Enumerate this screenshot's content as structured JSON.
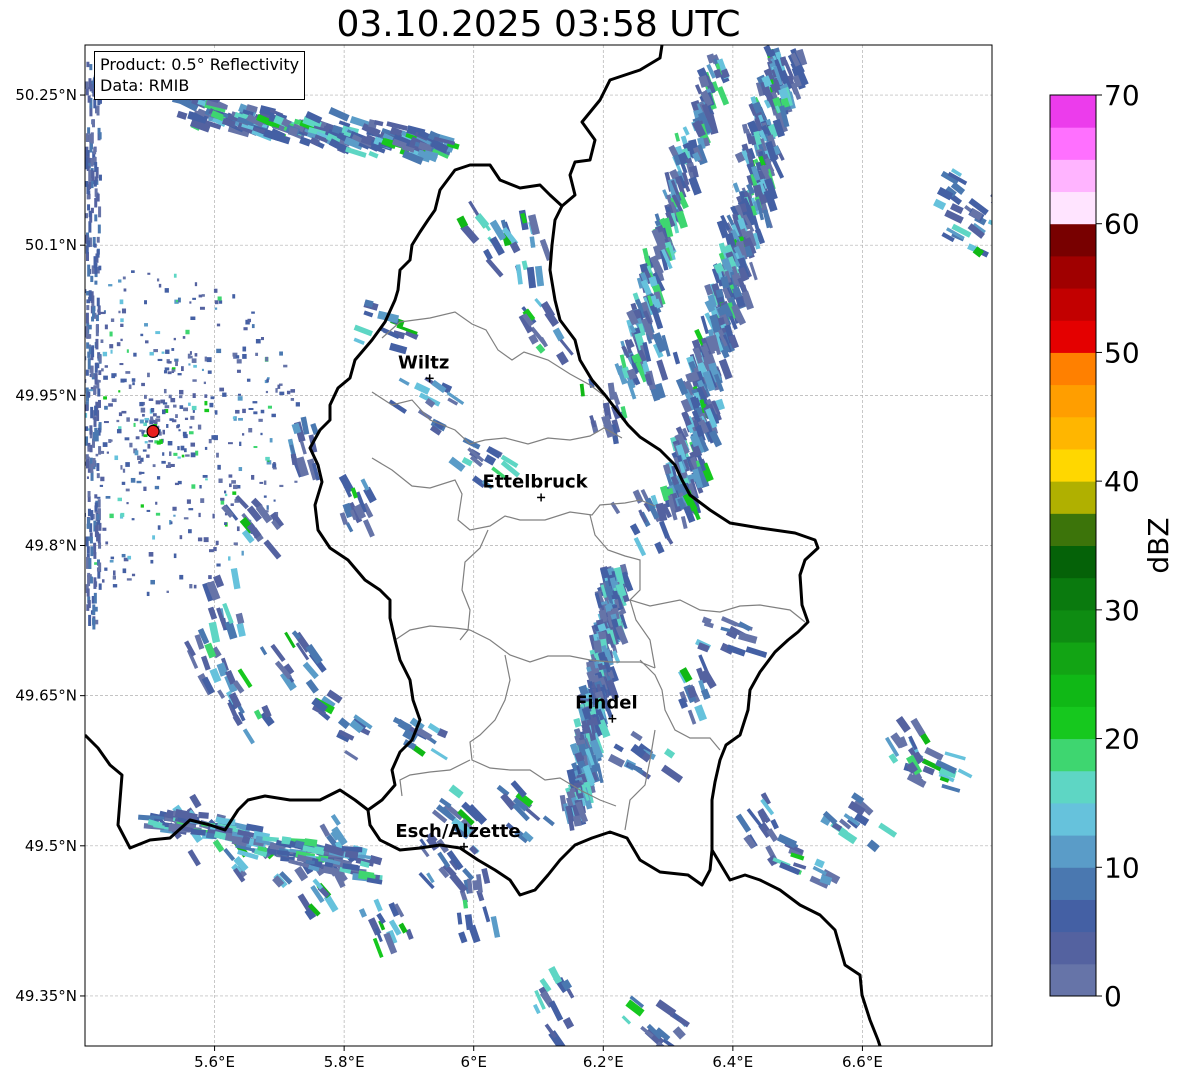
{
  "title": "03.10.2025 03:58 UTC",
  "info": {
    "product": "Product: 0.5° Reflectivity",
    "data": "Data: RMIB"
  },
  "map": {
    "lon_range": [
      5.4,
      6.8
    ],
    "lat_range": [
      49.3,
      50.3
    ],
    "x_ticks": [
      {
        "value": 5.6,
        "label": "5.6°E"
      },
      {
        "value": 5.8,
        "label": "5.8°E"
      },
      {
        "value": 6.0,
        "label": "6°E"
      },
      {
        "value": 6.2,
        "label": "6.2°E"
      },
      {
        "value": 6.4,
        "label": "6.4°E"
      },
      {
        "value": 6.6,
        "label": "6.6°E"
      }
    ],
    "y_ticks": [
      {
        "value": 50.25,
        "label": "50.25°N"
      },
      {
        "value": 50.1,
        "label": "50.1°N"
      },
      {
        "value": 49.95,
        "label": "49.95°N"
      },
      {
        "value": 49.8,
        "label": "49.8°N"
      },
      {
        "value": 49.65,
        "label": "49.65°N"
      },
      {
        "value": 49.5,
        "label": "49.5°N"
      },
      {
        "value": 49.35,
        "label": "49.35°N"
      }
    ],
    "grid": true,
    "radar_site": {
      "lon": 5.505,
      "lat": 49.914,
      "color": "#e8201c"
    },
    "cities": [
      {
        "name": "Wiltz",
        "lon": 5.932,
        "lat": 49.967
      },
      {
        "name": "Ettelbruck",
        "lon": 6.104,
        "lat": 49.848
      },
      {
        "name": "Findel",
        "lon": 6.214,
        "lat": 49.627
      },
      {
        "name": "Esch/Alzette",
        "lon": 5.985,
        "lat": 49.499
      }
    ]
  },
  "colorbar": {
    "label": "dBZ",
    "min": 0,
    "max": 70,
    "tick_values": [
      0,
      10,
      20,
      30,
      40,
      50,
      60,
      70
    ],
    "tick_labels": [
      "0",
      "10",
      "20",
      "30",
      "40",
      "50",
      "60",
      "70"
    ],
    "colors": [
      "#6674a8",
      "#5462a0",
      "#4460a4",
      "#4a78b0",
      "#5a9cc8",
      "#66c2dc",
      "#5ed6c4",
      "#3ed670",
      "#16c81e",
      "#10b816",
      "#12a414",
      "#0e8c12",
      "#0a7a0e",
      "#056208",
      "#3c740a",
      "#b0b000",
      "#ffd700",
      "#ffb600",
      "#ff9e00",
      "#ff8000",
      "#e40000",
      "#c20000",
      "#a00000",
      "#780000",
      "#ffe4ff",
      "#ffb4ff",
      "#ff70ff",
      "#ec3cec"
    ]
  }
}
